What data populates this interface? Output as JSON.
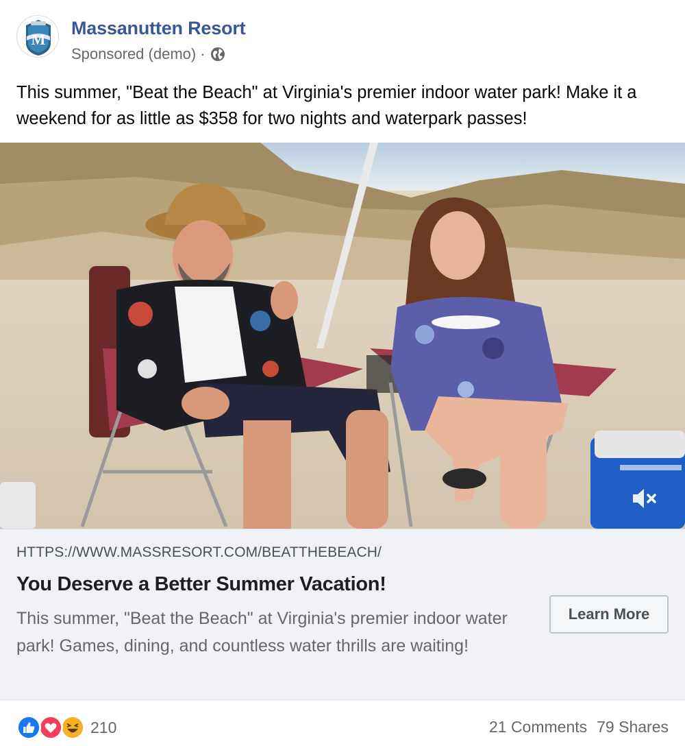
{
  "post": {
    "page_name": "Massanutten Resort",
    "sponsored_label": "Sponsored (demo)",
    "separator": "·",
    "avatar_letter": "M",
    "caption": "This summer, \"Beat the Beach\" at Virginia's premier indoor water park! Make it a weekend for as little as $358 for two nights and waterpark passes!"
  },
  "link": {
    "url": "HTTPS://WWW.MASSRESORT.COM/BEATTHEBEACH/",
    "title": "You Deserve a Better Summer Vacation!",
    "description": "This summer, \"Beat the Beach\" at Virginia's premier indoor water park! Games, dining, and countless water thrills are waiting!",
    "cta_label": "Learn More"
  },
  "engagement": {
    "reaction_count": "210",
    "comments": "21 Comments",
    "shares": "79 Shares"
  },
  "colors": {
    "page_name": "#385898",
    "like_blue": "#1877f2",
    "love_red": "#f33e58",
    "haha_yellow": "#f7b125"
  },
  "icons": [
    "globe-icon",
    "mute-icon",
    "like-reaction-icon",
    "love-reaction-icon",
    "haha-reaction-icon"
  ]
}
